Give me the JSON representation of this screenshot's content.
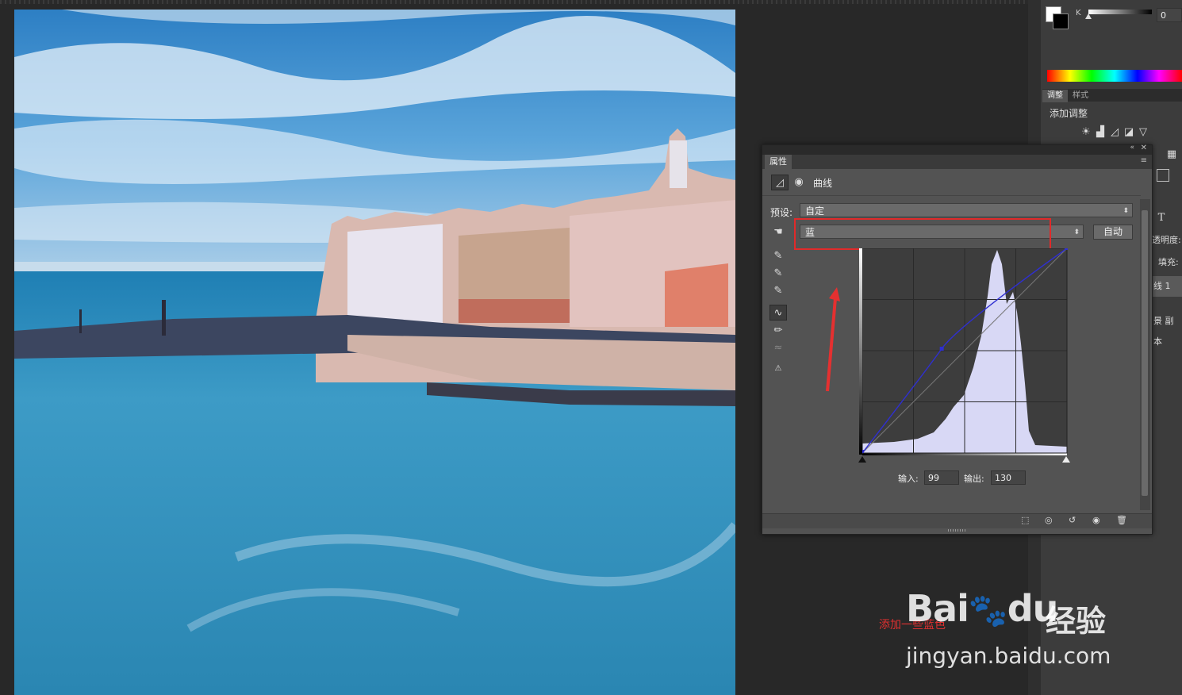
{
  "canvas": {
    "photo_alt": ""
  },
  "color_panel": {
    "channel_label": "K",
    "value": "0"
  },
  "adjustments_panel": {
    "tabs": [
      {
        "label": "调整",
        "active": true
      },
      {
        "label": "样式",
        "active": false
      }
    ],
    "add_label": "添加调整"
  },
  "properties_panel": {
    "tab_label": "属性",
    "type_label": "曲线",
    "preset_label": "预设:",
    "preset_value": "自定",
    "channel_value": "蓝",
    "auto_button": "自动",
    "input_label": "输入:",
    "input_value": "99",
    "output_label": "输出:",
    "output_value": "130",
    "curve_color": "#2f2fd0",
    "histogram_color": "#d8d8f5"
  },
  "layers_panel": {
    "opacity_label": "透明度:",
    "fill_label": "填充:",
    "rows": [
      {
        "label": "线 1"
      },
      {
        "label": "景 副本"
      }
    ]
  },
  "annotation": {
    "text": "添加一些蓝色",
    "color": "#e03030"
  },
  "watermark": {
    "brand": "Bai",
    "brand_suffix": "du",
    "product": "经验",
    "url": "jingyan.baidu.com"
  }
}
